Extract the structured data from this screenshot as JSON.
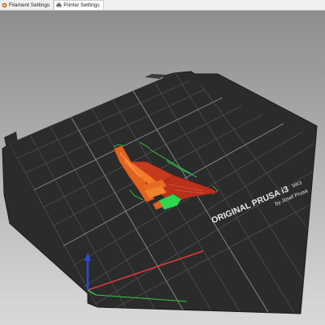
{
  "tabs": [
    {
      "label": "Filament Settings",
      "icon": "spool-icon",
      "active": false
    },
    {
      "label": "Printer Settings",
      "icon": "printer-icon",
      "active": true
    }
  ],
  "bed": {
    "brand": "ORIGINAL PRUSA i3",
    "model": "MK3",
    "byline": "by Josef Prusa"
  },
  "colors": {
    "background": "#b3b3b3",
    "bed": "#2a2a2a",
    "grid": "#555555",
    "part_orange": "#e0621e",
    "part_red": "#c0331c",
    "selection_green": "#2fd44f",
    "axis_x": "#e23a3a",
    "axis_y": "#2ecc40",
    "axis_z": "#2a4bd0"
  }
}
